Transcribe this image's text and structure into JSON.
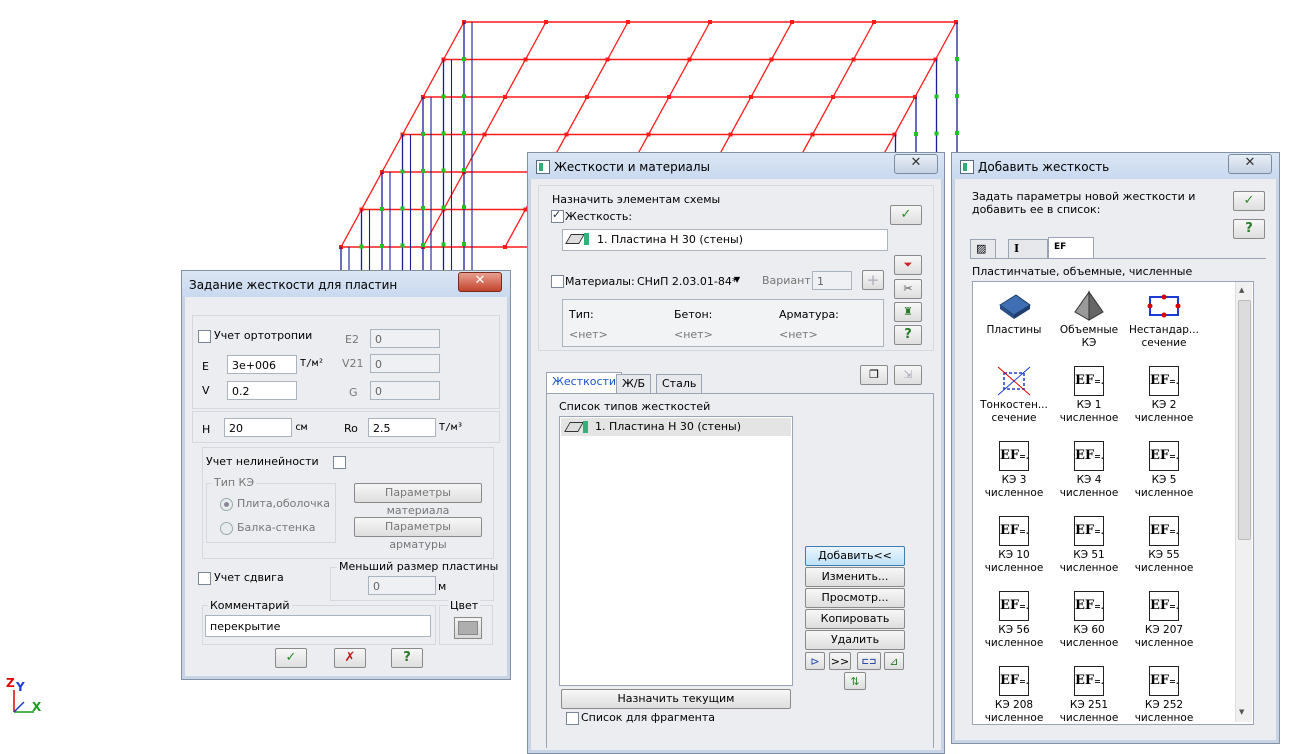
{
  "axes": {
    "z": "Z",
    "y": "Y",
    "x": "X"
  },
  "dlg_plate": {
    "title": "Задание жесткости для пластин",
    "close": "✕",
    "ortho_label": "Учет ортотропии",
    "E_label": "E",
    "E_value": "3e+006",
    "E_unit": "Т/м²",
    "V_label": "V",
    "V_value": "0.2",
    "E2_label": "E2",
    "E2_value": "0",
    "V21_label": "V21",
    "V21_value": "0",
    "G_label": "G",
    "G_value": "0",
    "H_label": "H",
    "H_value": "20",
    "H_unit": "см",
    "Ro_label": "Ro",
    "Ro_value": "2.5",
    "Ro_unit": "Т/м³",
    "nonlin_label": "Учет нелинейности",
    "fe_type_label": "Тип КЭ",
    "radio_plate": "Плита,оболочка",
    "radio_beam": "Балка-стенка",
    "btn_mat_params": "Параметры материала",
    "btn_rebar_params": "Параметры арматуры",
    "shear_label": "Учет сдвига",
    "min_size_label": "Меньший размер пластины",
    "min_size_value": "0",
    "min_size_unit": "м",
    "comment_label": "Комментарий",
    "comment_value": "перекрытие",
    "color_label": "Цвет",
    "ok": "✓",
    "cancel": "✗",
    "help": "?"
  },
  "dlg_stiff": {
    "title": "Жесткости и материалы",
    "close": "✕",
    "assign_label": "Назначить элементам схемы",
    "stiff_label": "Жесткость:",
    "stiff_value": "1. Пластина  Н 30 (стены)",
    "materials_label": "Материалы:",
    "materials_value": "СНиП 2.03.01-84*",
    "variant_label": "Вариант",
    "variant_value": "1",
    "col_type": "Тип:",
    "col_concrete": "Бетон:",
    "col_rebar": "Арматура:",
    "none": "<нет>",
    "tabs": [
      "Жесткости",
      "Ж/Б",
      "Сталь"
    ],
    "list_label": "Список типов жесткостей",
    "list_items": [
      "1. Пластина  Н 30 (стены)"
    ],
    "btn_add": "Добавить<<",
    "btn_edit": "Изменить...",
    "btn_view": "Просмотр...",
    "btn_copy": "Копировать",
    "btn_delete": "Удалить",
    "btn_current": "Назначить текущим",
    "fragment_label": "Список для фрагмента",
    "ok": "✓",
    "help": "?",
    "arrows": ">>"
  },
  "dlg_add": {
    "title": "Добавить жесткость",
    "close": "✕",
    "prompt": "Задать параметры новой жесткости и добавить ее в список:",
    "category": "Пластинчатые, объемные, численные",
    "ok": "✓",
    "help": "?",
    "tiles": [
      {
        "l1": "Пластины",
        "l2": ""
      },
      {
        "l1": "Объемные",
        "l2": "КЭ"
      },
      {
        "l1": "Нестандар...",
        "l2": "сечение"
      },
      {
        "l1": "Тонкостен...",
        "l2": "сечение"
      },
      {
        "l1": "КЭ 1",
        "l2": "численное"
      },
      {
        "l1": "КЭ 2",
        "l2": "численное"
      },
      {
        "l1": "КЭ 3",
        "l2": "численное"
      },
      {
        "l1": "КЭ 4",
        "l2": "численное"
      },
      {
        "l1": "КЭ 5",
        "l2": "численное"
      },
      {
        "l1": "КЭ 10",
        "l2": "численное"
      },
      {
        "l1": "КЭ 51",
        "l2": "численное"
      },
      {
        "l1": "КЭ 55",
        "l2": "численное"
      },
      {
        "l1": "КЭ 56",
        "l2": "численное"
      },
      {
        "l1": "КЭ 60",
        "l2": "численное"
      },
      {
        "l1": "КЭ 207",
        "l2": "численное"
      },
      {
        "l1": "КЭ 208",
        "l2": "численное"
      },
      {
        "l1": "КЭ 251",
        "l2": "численное"
      },
      {
        "l1": "КЭ 252",
        "l2": "численное"
      }
    ]
  }
}
